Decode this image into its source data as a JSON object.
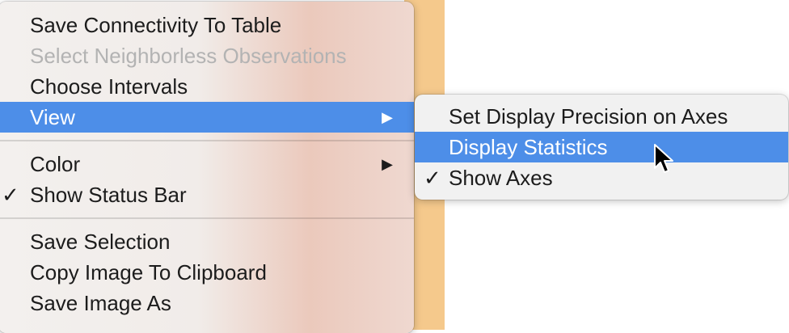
{
  "main_menu": {
    "items": [
      {
        "label": "Save Connectivity To Table"
      },
      {
        "label": "Select Neighborless Observations"
      },
      {
        "label": "Choose Intervals"
      },
      {
        "label": "View",
        "arrow": "▶"
      },
      {
        "label": "Color",
        "arrow": "▶"
      },
      {
        "label": "Show Status Bar",
        "check": "✓"
      },
      {
        "label": "Save Selection"
      },
      {
        "label": "Copy Image To Clipboard"
      },
      {
        "label": "Save Image As"
      }
    ]
  },
  "view_submenu": {
    "items": [
      {
        "label": "Set Display Precision on Axes"
      },
      {
        "label": "Display Statistics"
      },
      {
        "label": "Show Axes",
        "check": "✓"
      }
    ]
  },
  "colors": {
    "highlight": "#4d8ee8",
    "disabled_text": "#b3b3b3",
    "background_strip": "#f5c98c"
  },
  "icons": {
    "cursor": "arrow-pointer",
    "submenu_arrow": "triangle-right",
    "check": "check-mark"
  }
}
